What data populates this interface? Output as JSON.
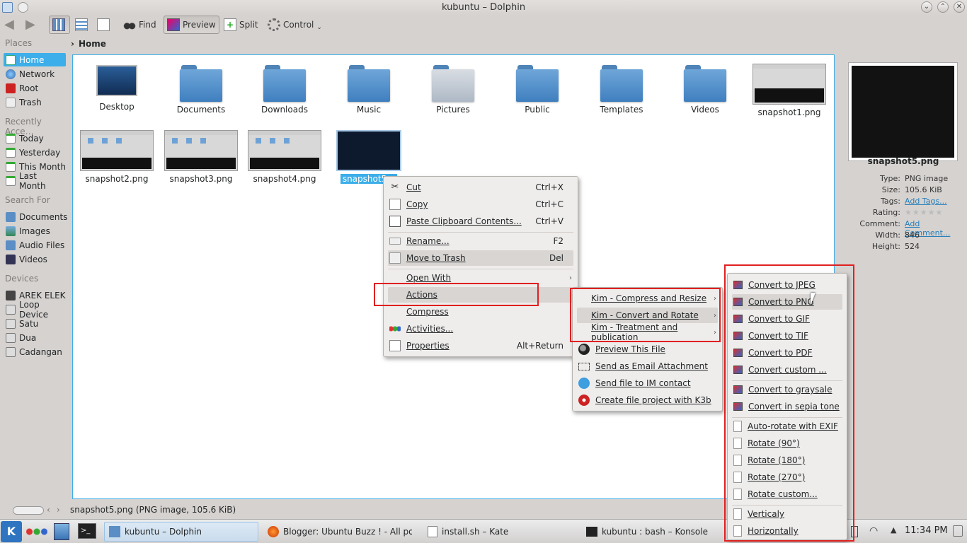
{
  "window": {
    "title": "kubuntu – Dolphin"
  },
  "toolbar": {
    "find": "Find",
    "preview": "Preview",
    "split": "Split",
    "control": "Control"
  },
  "places": {
    "sections": {
      "places": "Places",
      "recent": "Recently Acce…",
      "search": "Search For",
      "devices": "Devices"
    },
    "places_items": [
      "Home",
      "Network",
      "Root",
      "Trash"
    ],
    "recent_items": [
      "Today",
      "Yesterday",
      "This Month",
      "Last Month"
    ],
    "search_items": [
      "Documents",
      "Images",
      "Audio Files",
      "Videos"
    ],
    "device_items": [
      "AREK ELEK",
      "Loop Device",
      "Satu",
      "Dua",
      "Cadangan"
    ]
  },
  "breadcrumb": {
    "current": "Home"
  },
  "files": {
    "row1": [
      "Desktop",
      "Documents",
      "Downloads",
      "Music",
      "Pictures",
      "Public",
      "Templates",
      "Videos",
      "snapshot1.png"
    ],
    "row2": [
      "snapshot2.png",
      "snapshot3.png",
      "snapshot4.png",
      "snapshot5…"
    ]
  },
  "context_menu": {
    "items": [
      {
        "label": "Cut",
        "shortcut": "Ctrl+X"
      },
      {
        "label": "Copy",
        "shortcut": "Ctrl+C"
      },
      {
        "label": "Paste Clipboard Contents...",
        "shortcut": "Ctrl+V"
      },
      {
        "label": "Rename...",
        "shortcut": "F2"
      },
      {
        "label": "Move to Trash",
        "shortcut": "Del"
      },
      {
        "label": "Open With",
        "shortcut": ""
      },
      {
        "label": "Actions",
        "shortcut": ""
      },
      {
        "label": "Compress",
        "shortcut": ""
      },
      {
        "label": "Activities...",
        "shortcut": ""
      },
      {
        "label": "Properties",
        "shortcut": "Alt+Return"
      }
    ]
  },
  "actions_menu": {
    "items": [
      "Kim - Compress and Resize",
      "Kim - Convert and Rotate",
      "Kim - Treatment and publication",
      "Preview This File",
      "Send as Email Attachment",
      "Send file to IM contact",
      "Create file project with K3b"
    ]
  },
  "convert_menu": {
    "items": [
      "Convert to JPEG",
      "Convert to PNG",
      "Convert to GIF",
      "Convert to TIF",
      "Convert to PDF",
      "Convert custom ...",
      "Convert to graysale",
      "Convert in sepia tone",
      "Auto-rotate with EXIF",
      "Rotate (90°)",
      "Rotate (180°)",
      "Rotate (270°)",
      "Rotate custom...",
      "Verticaly",
      "Horizontally"
    ]
  },
  "info_panel": {
    "filename": "snapshot5.png",
    "rows": [
      {
        "key": "Type:",
        "value": "PNG image"
      },
      {
        "key": "Size:",
        "value": "105.6 KiB"
      },
      {
        "key": "Tags:",
        "value": "Add Tags..."
      },
      {
        "key": "Rating:",
        "value": ""
      },
      {
        "key": "Comment:",
        "value": "Add Comment..."
      },
      {
        "key": "Width:",
        "value": "846"
      },
      {
        "key": "Height:",
        "value": "524"
      }
    ],
    "rating_stars": 0
  },
  "status": {
    "text": "snapshot5.png (PNG image, 105.6 KiB)"
  },
  "taskbar": {
    "tasks": [
      "kubuntu – Dolphin",
      "Blogger: Ubuntu Buzz ! - All posts",
      "install.sh – Kate",
      "kubuntu : bash – Konsole"
    ],
    "clock": "11:34 PM"
  },
  "colors": {
    "selection": "#3daee9",
    "annotation_box": "#e02020",
    "link": "#2980b9"
  }
}
